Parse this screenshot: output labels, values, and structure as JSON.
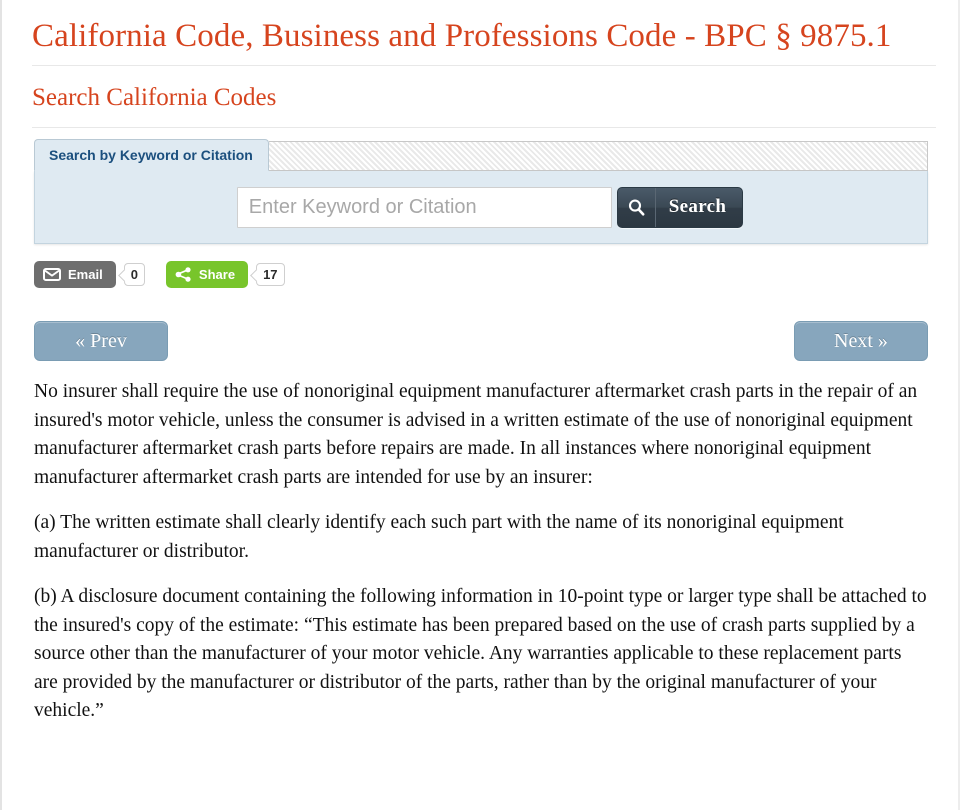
{
  "document": {
    "title": "California Code, Business and Professions Code - BPC § 9875.1",
    "section_heading": "Search California Codes"
  },
  "search": {
    "tab_label": "Search by Keyword or Citation",
    "placeholder": "Enter Keyword or Citation",
    "value": "",
    "button_label": "Search",
    "search_icon": "magnifier-icon",
    "panel_bg": "#dfeaf2",
    "button_bg": "#36424d"
  },
  "social": {
    "email": {
      "label": "Email",
      "count": "0",
      "icon": "envelope-icon",
      "color": "#6e6e6e"
    },
    "share": {
      "label": "Share",
      "count": "17",
      "icon": "share-nodes-icon",
      "color": "#78c52b"
    }
  },
  "pagination": {
    "prev_label": "« Prev",
    "next_label": "Next »",
    "button_color": "#87a6bd"
  },
  "content": {
    "paragraphs": [
      "No insurer shall require the use of nonoriginal equipment manufacturer aftermarket crash parts in the repair of an insured's motor vehicle, unless the consumer is advised in a written estimate of the use of nonoriginal equipment manufacturer aftermarket crash parts before repairs are made.   In all instances where nonoriginal equipment manufacturer aftermarket crash parts are intended for use by an insurer:",
      "(a)  The written estimate shall clearly identify each such part with the name of its nonoriginal equipment manufacturer or distributor.",
      "(b)  A disclosure document containing the following information in 10-point type or larger type shall be attached to the insured's copy of the estimate:  “This estimate has been prepared based on the use of crash parts supplied by a source other than the manufacturer of your motor vehicle.   Any warranties applicable to these replacement parts are provided by the manufacturer or distributor of the parts, rather than by the original manufacturer of your vehicle.”"
    ]
  },
  "theme": {
    "title_color": "#d6441e",
    "body_color": "#111111",
    "tab_text_color": "#1b4f7e"
  }
}
